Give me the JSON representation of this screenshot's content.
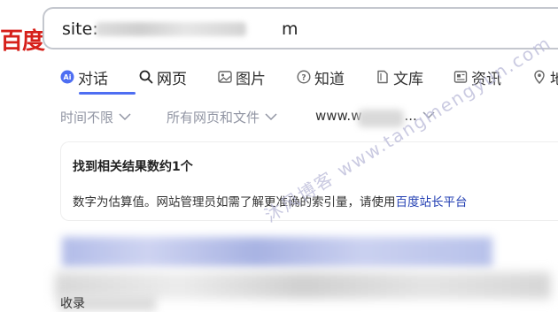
{
  "logo": {
    "text": "百度"
  },
  "search": {
    "value": "site:",
    "value_tail": "m"
  },
  "tabs": [
    {
      "label": "对话",
      "icon": "ai-chat-icon"
    },
    {
      "label": "网页",
      "icon": "search-icon",
      "active": true
    },
    {
      "label": "图片",
      "icon": "image-icon"
    },
    {
      "label": "知道",
      "icon": "question-icon"
    },
    {
      "label": "文库",
      "icon": "document-icon"
    },
    {
      "label": "资讯",
      "icon": "news-icon"
    },
    {
      "label": "地",
      "icon": "map-icon"
    }
  ],
  "filters": [
    {
      "label": "时间不限"
    },
    {
      "label": "所有网页和文件"
    },
    {
      "label": "www.w",
      "tail": "..."
    }
  ],
  "info_card": {
    "title": "找到相关结果数约1个",
    "desc": "数字为估算值。网站管理员如需了解更准确的索引量，请使用",
    "link": "百度站长平台"
  },
  "result": {
    "fragment": "收录"
  },
  "watermark": {
    "text": "沐风博客 www.tangmengyun.com"
  },
  "colors": {
    "accent": "#4e6ef2",
    "link": "#2440b3",
    "logo_red": "#d6201a"
  }
}
